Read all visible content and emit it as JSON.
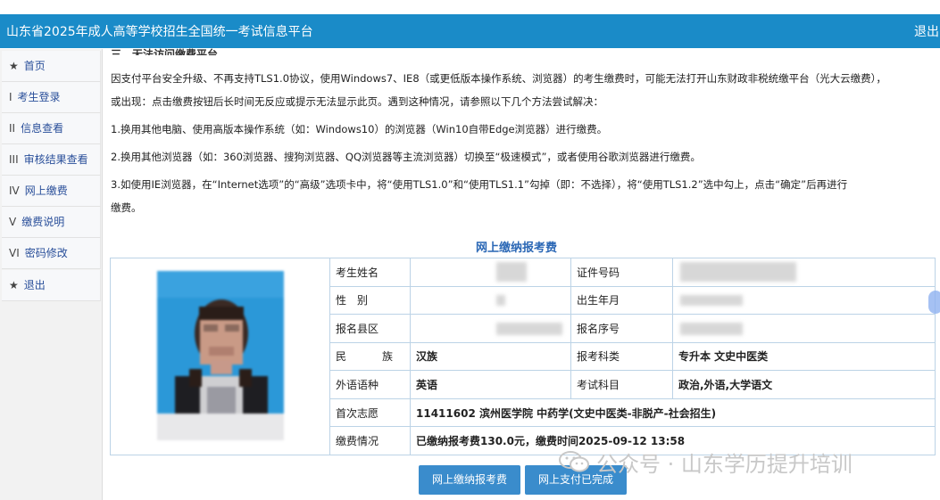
{
  "header": {
    "title": "山东省2025年成人高等学校招生全国统一考试信息平台",
    "logout_label": "退出"
  },
  "sidebar": {
    "items": [
      {
        "prefix": "★",
        "label": "首页"
      },
      {
        "prefix": "I",
        "label": "考生登录"
      },
      {
        "prefix": "II",
        "label": "信息查看"
      },
      {
        "prefix": "III",
        "label": "审核结果查看"
      },
      {
        "prefix": "IV",
        "label": "网上缴费"
      },
      {
        "prefix": "V",
        "label": "缴费说明"
      },
      {
        "prefix": "VI",
        "label": "密码修改"
      },
      {
        "prefix": "★",
        "label": "退出"
      }
    ]
  },
  "notice": {
    "heading": "三、无法访问缴费平台",
    "lines": [
      "因支付平台安全升级、不再支持TLS1.0协议，使用Windows7、IE8（或更低版本操作系统、浏览器）的考生缴费时，可能无法打开山东财政非税统缴平台（光大云缴费），",
      "或出现：点击缴费按钮后长时间无反应或提示无法显示此页。遇到这种情况，请参照以下几个方法尝试解决：",
      "1.换用其他电脑、使用高版本操作系统（如：Windows10）的浏览器（Win10自带Edge浏览器）进行缴费。",
      "2.换用其他浏览器（如：360浏览器、搜狗浏览器、QQ浏览器等主流浏览器）切换至“极速模式”，或者使用谷歌浏览器进行缴费。",
      "3.如使用IE浏览器，在“Internet选项”的“高级”选项卡中，将“使用TLS1.0”和“使用TLS1.1”勾掉（即：不选择），将“使用TLS1.2”选中勾上，点击“确定”后再进行",
      "缴费。"
    ]
  },
  "form": {
    "title": "网上缴纳报考费",
    "labels": {
      "name": "考生姓名",
      "id_number": "证件号码",
      "gender": "性　别",
      "birth": "出生年月",
      "county": "报名县区",
      "reg_no": "报名序号",
      "ethnicity": "民　族",
      "category": "报考科类",
      "language": "外语语种",
      "subjects": "考试科目",
      "first_choice": "首次志愿",
      "payment_status": "缴费情况"
    },
    "values": {
      "ethnicity": "汉族",
      "category": "专升本 文史中医类",
      "language": "英语",
      "subjects": "政治,外语,大学语文",
      "first_choice": "11411602 滨州医学院 中药学(文史中医类-非脱产-社会招生)",
      "payment_status": "已缴纳报考费130.0元，缴费时间2025-09-12 13:58"
    }
  },
  "buttons": {
    "pay_label": "网上缴纳报考费",
    "completed_label": "网上支付已完成"
  },
  "watermark": {
    "text": "公众号 · 山东学历提升培训"
  },
  "colors": {
    "header_bg": "#1a8bc8",
    "button_bg": "#3a8ccc",
    "table_border": "#bcd3e6",
    "nav_text": "#2a4f9a"
  }
}
